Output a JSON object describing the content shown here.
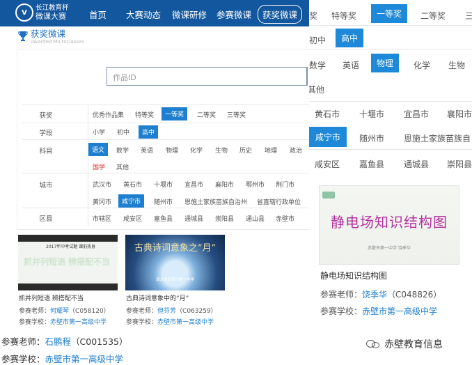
{
  "background": {
    "award_tabs": [
      "奖",
      "特等奖",
      "一等奖",
      "二等奖",
      "三"
    ],
    "stage_opts": [
      "初中",
      "高中"
    ],
    "subjects": [
      "数学",
      "英语",
      "物理",
      "化学",
      "生物"
    ],
    "subject_other": "其他",
    "cities_row1": [
      "黄石市",
      "十堰市",
      "宜昌市",
      "襄阳市"
    ],
    "cities_row2": [
      "咸宁市",
      "随州市",
      "恩施土家族苗族自"
    ],
    "districts": [
      "咸安区",
      "嘉鱼县",
      "通城县",
      "崇阳县"
    ],
    "video": {
      "thumb_title": "静电场知识结构图",
      "thumb_sub": "赤壁市第一中学  饶季华",
      "title": "静电场知识结构图",
      "teacher_label": "参赛老师：",
      "teacher_name": "饶季华",
      "teacher_code": "（C048826）",
      "school_label": "参赛学校：",
      "school_name": "赤壁市第一高级中学"
    },
    "bottom_teacher_label": "参赛老师：",
    "bottom_teacher_name": "石鹏程",
    "bottom_teacher_code": "（C001535）",
    "bottom_school_label": "参赛学校：",
    "bottom_school_name": "赤壁市第一高级中学",
    "watermark": "赤壁教育信息"
  },
  "nav": {
    "brand_line1": "长江教育杯",
    "brand_line2": "微课大赛",
    "items": [
      "首页",
      "大赛动态",
      "微课研修",
      "参赛微课",
      "获奖微课"
    ]
  },
  "section": {
    "title": "获奖微课",
    "subtitle": "Awarded Microclasses"
  },
  "search": {
    "placeholder": "作品ID"
  },
  "filters": {
    "award": {
      "label": "获奖",
      "options": [
        "优秀作品集",
        "特等奖",
        "一等奖",
        "二等奖",
        "三等奖"
      ]
    },
    "stage": {
      "label": "学段",
      "options": [
        "小学",
        "初中",
        "高中"
      ]
    },
    "subject": {
      "label": "科目",
      "row1": [
        "语文",
        "数学",
        "英语",
        "物理",
        "化学",
        "生物",
        "历史",
        "地理",
        "政治"
      ],
      "row2": [
        "国学",
        "其他"
      ]
    },
    "city": {
      "label": "城市",
      "row1": [
        "武汉市",
        "黄石市",
        "十堰市",
        "宜昌市",
        "襄阳市",
        "鄂州市",
        "荆门市"
      ],
      "row2": [
        "黄冈市",
        "咸宁市",
        "随州市",
        "恩施土家族苗族自治州",
        "省直辖行政单位"
      ]
    },
    "district": {
      "label": "区县",
      "options": [
        "市辖区",
        "咸安区",
        "嘉鱼县",
        "通城县",
        "崇阳县",
        "通山县",
        "赤壁市"
      ]
    }
  },
  "videos": [
    {
      "thumb_line1": "2017年中考试题  课前热身",
      "thumb_line2": "抓并列短语 辨搭配不当",
      "title": "抓并列短语 辨搭配不当",
      "teacher_label": "参赛老师：",
      "teacher_name": "何耀琴",
      "teacher_code": "（C058120）",
      "school_label": "参赛学校：",
      "school_name": "赤壁市第一高级中学"
    },
    {
      "thumb_line1": "古典诗词意象之“月”",
      "thumb_line2": "湖北省赤壁市第一中学",
      "title": "古典诗词意象中的“月”",
      "teacher_label": "参赛老师：",
      "teacher_name": "但芬芳",
      "teacher_code": "（C063259）",
      "school_label": "参赛学校：",
      "school_name": "赤壁市第一高级中学"
    }
  ]
}
